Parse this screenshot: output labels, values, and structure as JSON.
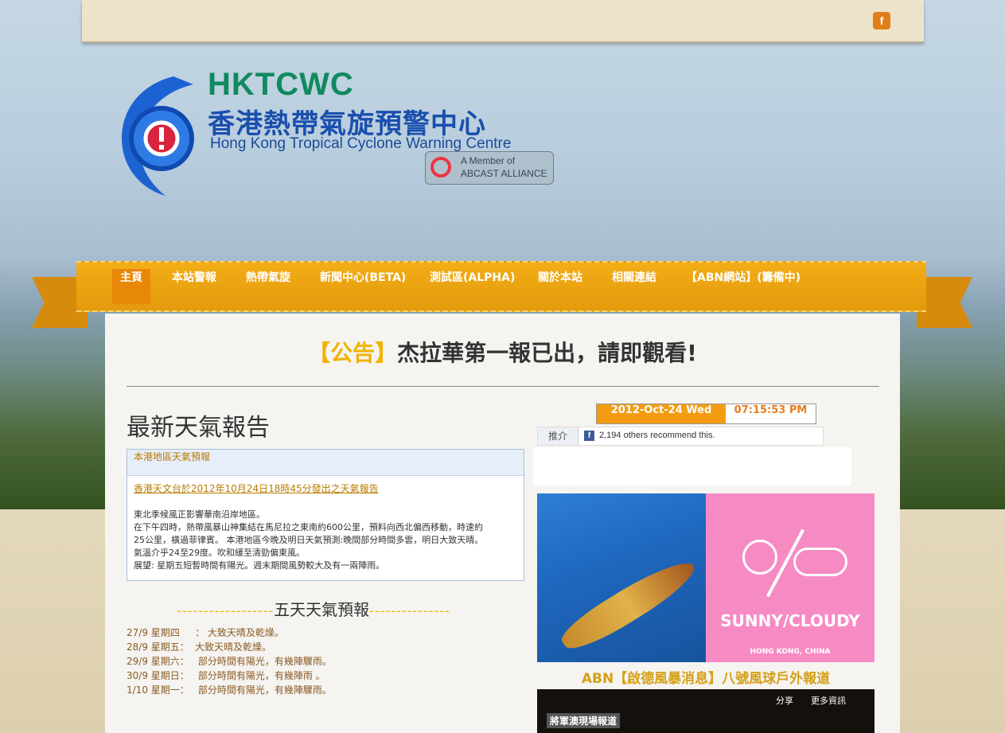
{
  "header": {
    "facebook_icon": "f",
    "logo_short": "HKTCWC",
    "logo_zh": "香港熱帶氣旋預警中心",
    "logo_en": "Hong Kong Tropical Cyclone Warning Centre",
    "abcast_line1": "A Member of",
    "abcast_line2": "ABCAST ALLIANCE"
  },
  "nav": [
    {
      "label": "主頁"
    },
    {
      "label": "本站警報"
    },
    {
      "label": "熱帶氣旋"
    },
    {
      "label": "新聞中心(BETA)"
    },
    {
      "label": "測試區(ALPHA)"
    },
    {
      "label": "關於本站"
    },
    {
      "label": "相關連結"
    },
    {
      "label": "【ABN網站】(籌備中)"
    }
  ],
  "notice": {
    "tag": "【公告】",
    "text": "杰拉華第一報已出，請即觀看!"
  },
  "latest": {
    "title": "最新天氣報告",
    "box_header": "本港地區天氣預報",
    "link": "香港天文台於2012年10月24日18時45分發出之天氣報告",
    "body": [
      "東北季候風正影響華南沿岸地區。",
      "在下午四時，熱帶風暴山神集結在馬尼拉之東南約600公里，預料向西北偏西移動，時速約",
      "25公里，橫過菲律賓。 本港地區今晚及明日天氣預測:晚間部分時間多雲，明日大致天晴。",
      "氣溫介乎24至29度。吹和緩至清勁偏東風。",
      "展望: 星期五短暫時間有陽光。週末期間風勢較大及有一兩陣雨。"
    ]
  },
  "forecast": {
    "title": "五天天氣預報",
    "left_dashes": "------------------",
    "right_dashes": "---------------",
    "days": [
      {
        "day": "27/9 星期四",
        "sep": "：",
        "desc": "大致天晴及乾燥。"
      },
      {
        "day": "28/9 星期五：",
        "sep": "",
        "desc": "大致天晴及乾燥。"
      },
      {
        "day": "29/9 星期六：",
        "sep": "",
        "desc": "部分時間有陽光，有幾陣驟雨。"
      },
      {
        "day": "30/9 星期日：",
        "sep": "",
        "desc": "部分時間有陽光，有幾陣雨 。"
      },
      {
        "day": "1/10 星期一：",
        "sep": "",
        "desc": "部分時間有陽光，有幾陣驟雨。"
      }
    ]
  },
  "clock": {
    "date": "2012-Oct-24  Wed",
    "time": "07:15:53  PM"
  },
  "facebook": {
    "like_label": "推介",
    "count_text": "2,194 others recommend this."
  },
  "weather_card": {
    "label": "SUNNY/CLOUDY",
    "location": "HONG KONG, CHINA"
  },
  "abn": {
    "title": "ABN【啟德風暴消息】八號風球戶外報道",
    "share": "分享",
    "more": "更多資訊",
    "caption": "將軍澳現場報道"
  }
}
